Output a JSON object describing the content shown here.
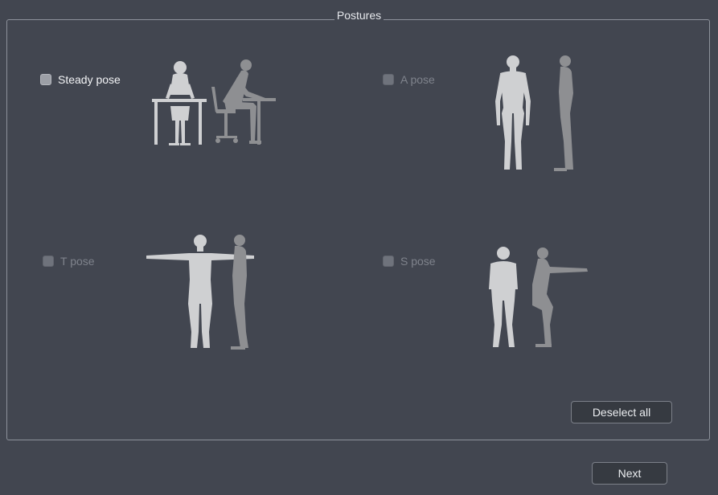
{
  "group": {
    "title": "Postures"
  },
  "options": [
    {
      "label": "Steady pose",
      "checked": false,
      "enabled": true
    },
    {
      "label": "A pose",
      "checked": false,
      "enabled": false
    },
    {
      "label": "T pose",
      "checked": false,
      "enabled": false
    },
    {
      "label": "S pose",
      "checked": false,
      "enabled": false
    }
  ],
  "buttons": {
    "deselect_all": "Deselect all",
    "next": "Next"
  },
  "colors": {
    "background": "#424650",
    "frame_border": "#8d929b",
    "figure_front": "#cfd0d2",
    "figure_side": "#8e8f92"
  }
}
